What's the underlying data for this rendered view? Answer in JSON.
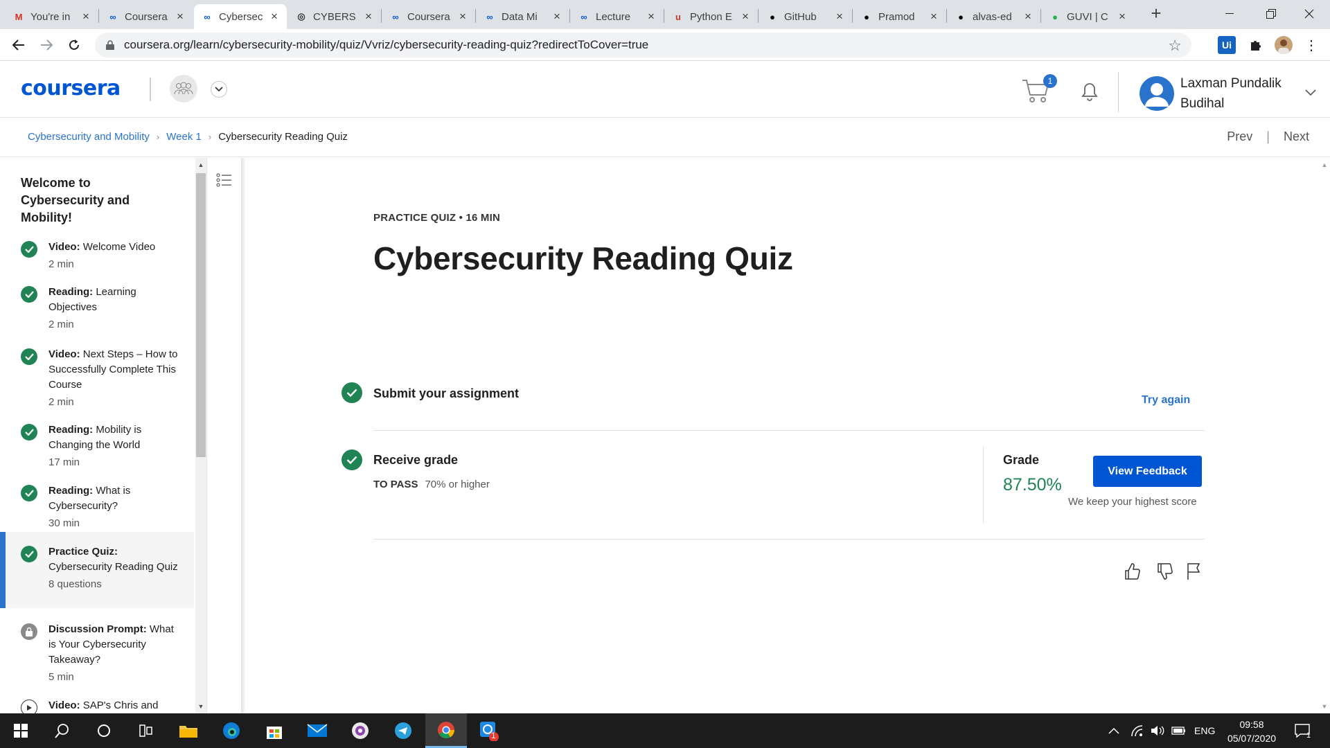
{
  "browser": {
    "tabs": [
      {
        "title": "You're in",
        "icon": "gmail-icon",
        "color": "#d93025"
      },
      {
        "title": "Coursera",
        "icon": "coursera-icon",
        "color": "#0056d2"
      },
      {
        "title": "Cybersec",
        "icon": "coursera-icon",
        "color": "#0056d2",
        "active": true
      },
      {
        "title": "CYBERS",
        "icon": "cyber-icon",
        "color": "#333333"
      },
      {
        "title": "Coursera",
        "icon": "coursera-icon",
        "color": "#0056d2"
      },
      {
        "title": "Data Mi",
        "icon": "coursera-icon",
        "color": "#0056d2"
      },
      {
        "title": "Lecture",
        "icon": "coursera-icon",
        "color": "#0056d2"
      },
      {
        "title": "Python E",
        "icon": "udemy-icon",
        "color": "#c0392b"
      },
      {
        "title": "GitHub",
        "icon": "github-icon",
        "color": "#000000"
      },
      {
        "title": "Pramod",
        "icon": "github-icon",
        "color": "#000000"
      },
      {
        "title": "alvas-ed",
        "icon": "github-icon",
        "color": "#000000"
      },
      {
        "title": "GUVI | C",
        "icon": "guvi-icon",
        "color": "#22b14c"
      }
    ],
    "url": "coursera.org/learn/cybersecurity-mobility/quiz/Vvriz/cybersecurity-reading-quiz?redirectToCover=true"
  },
  "header": {
    "logo": "coursera",
    "cart_count": "1",
    "user_name": "Laxman Pundalik Budihal"
  },
  "breadcrumb": {
    "course": "Cybersecurity and Mobility",
    "week": "Week 1",
    "current": "Cybersecurity Reading Quiz",
    "prev": "Prev",
    "next": "Next"
  },
  "sidebar": {
    "module_title": "Welcome to Cybersecurity and Mobility!",
    "items": [
      {
        "type": "Video:",
        "title": "Welcome Video",
        "meta": "2 min",
        "status": "completed"
      },
      {
        "type": "Reading:",
        "title": "Learning Objectives",
        "meta": "2 min",
        "status": "completed"
      },
      {
        "type": "Video:",
        "title": "Next Steps – How to Successfully Complete This Course",
        "meta": "2 min",
        "status": "completed"
      },
      {
        "type": "Reading:",
        "title": "Mobility is Changing the World",
        "meta": "17 min",
        "status": "completed"
      },
      {
        "type": "Reading:",
        "title": "What is Cybersecurity?",
        "meta": "30 min",
        "status": "completed"
      },
      {
        "type": "Practice Quiz:",
        "title": "Cybersecurity Reading Quiz",
        "meta": "8 questions",
        "status": "completed",
        "active": true
      },
      {
        "type": "Discussion Prompt:",
        "title": "What is Your Cybersecurity Takeaway?",
        "meta": "5 min",
        "status": "locked"
      },
      {
        "type": "Video:",
        "title": "SAP's Chris and",
        "meta": "",
        "status": "play"
      }
    ]
  },
  "main": {
    "eyebrow": "PRACTICE QUIZ • 16 MIN",
    "title": "Cybersecurity Reading Quiz",
    "step1_label": "Submit your assignment",
    "try_again": "Try again",
    "step2_label": "Receive grade",
    "to_pass_label": "TO PASS",
    "to_pass_value": "70% or higher",
    "grade_label": "Grade",
    "grade_value": "87.50%",
    "view_feedback": "View Feedback",
    "highest_note": "We keep your highest score"
  },
  "taskbar": {
    "language": "ENG",
    "time": "09:58",
    "date": "05/07/2020",
    "notification_count": "1",
    "app_badge": "1"
  },
  "colors": {
    "brand": "#0056d2",
    "link": "#2a73cc",
    "success": "#1f8354"
  }
}
